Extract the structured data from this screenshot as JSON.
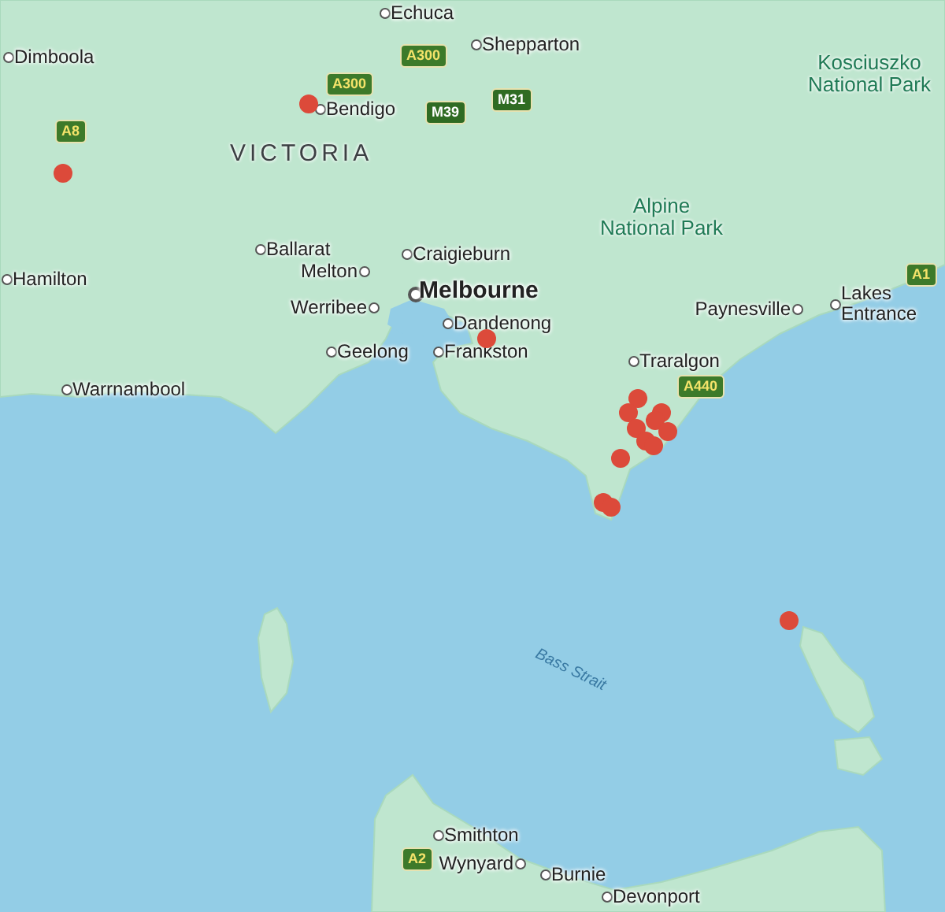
{
  "map": {
    "region_labels": [
      "VICTORIA"
    ],
    "park_labels": [
      "Kosciuszko National Park",
      "Alpine National Park"
    ],
    "water_labels": [
      "Bass Strait"
    ],
    "towns": [
      {
        "name": "Echuca",
        "kind": "town"
      },
      {
        "name": "Dimboola",
        "kind": "town"
      },
      {
        "name": "Shepparton",
        "kind": "town"
      },
      {
        "name": "Bendigo",
        "kind": "town"
      },
      {
        "name": "Ballarat",
        "kind": "town"
      },
      {
        "name": "Craigieburn",
        "kind": "town"
      },
      {
        "name": "Melton",
        "kind": "town"
      },
      {
        "name": "Melbourne",
        "kind": "city"
      },
      {
        "name": "Hamilton",
        "kind": "town"
      },
      {
        "name": "Werribee",
        "kind": "town"
      },
      {
        "name": "Paynesville",
        "kind": "town"
      },
      {
        "name": "Lakes Entrance",
        "kind": "town"
      },
      {
        "name": "Dandenong",
        "kind": "town"
      },
      {
        "name": "Geelong",
        "kind": "town"
      },
      {
        "name": "Frankston",
        "kind": "town"
      },
      {
        "name": "Traralgon",
        "kind": "town"
      },
      {
        "name": "Warrnambool",
        "kind": "town"
      },
      {
        "name": "Smithton",
        "kind": "town"
      },
      {
        "name": "Wynyard",
        "kind": "town"
      },
      {
        "name": "Burnie",
        "kind": "town"
      },
      {
        "name": "Devonport",
        "kind": "town"
      }
    ],
    "road_shields": [
      {
        "label": "A300",
        "kind": "highway"
      },
      {
        "label": "A300",
        "kind": "highway"
      },
      {
        "label": "M31",
        "kind": "freeway"
      },
      {
        "label": "M39",
        "kind": "freeway"
      },
      {
        "label": "A8",
        "kind": "highway"
      },
      {
        "label": "A1",
        "kind": "highway"
      },
      {
        "label": "A440",
        "kind": "highway"
      },
      {
        "label": "A2",
        "kind": "highway"
      }
    ]
  }
}
